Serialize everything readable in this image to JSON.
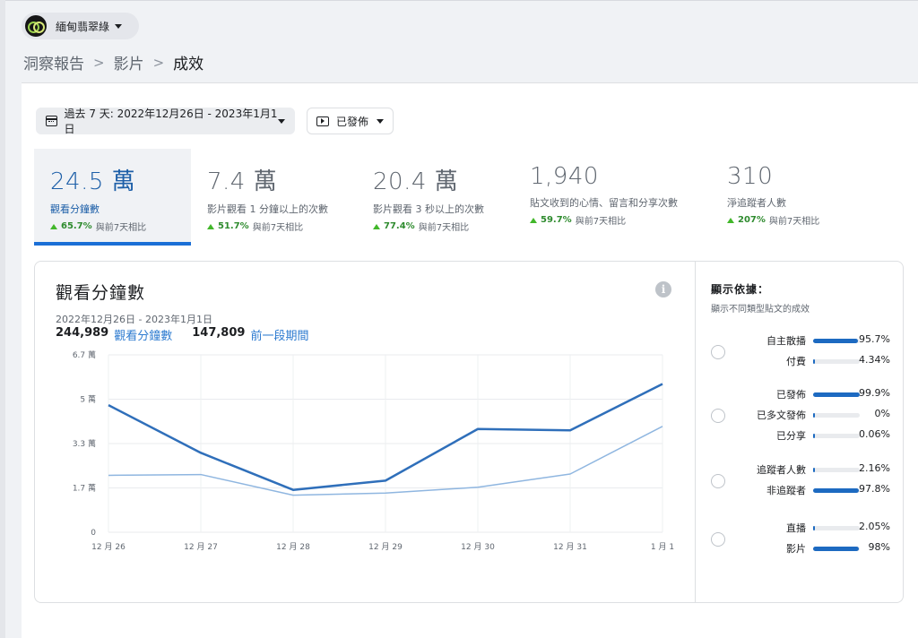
{
  "page_selector": {
    "name": "緬甸翡翠綠"
  },
  "breadcrumb": {
    "items": [
      "洞察報告",
      "影片",
      "成效"
    ],
    "separator": ">"
  },
  "filters": {
    "date_range_label": "過去 7 天: 2022年12月26日 - 2023年1月1日",
    "status_label": "已發佈"
  },
  "metrics": [
    {
      "value": "24.5 萬",
      "label": "觀看分鐘數",
      "change": "65.7%",
      "compare": "與前7天相比",
      "active": true
    },
    {
      "value": "7.4 萬",
      "label": "影片觀看 1 分鐘以上的次數",
      "change": "51.7%",
      "compare": "與前7天相比",
      "active": false
    },
    {
      "value": "20.4 萬",
      "label": "影片觀看 3 秒以上的次數",
      "change": "77.4%",
      "compare": "與前7天相比",
      "active": false
    },
    {
      "value": "1,940",
      "label": "貼文收到的心情、留言和分享次數",
      "change": "59.7%",
      "compare": "與前7天相比",
      "active": false
    },
    {
      "value": "310",
      "label": "淨追蹤者人數",
      "change": "207%",
      "compare": "與前7天相比",
      "active": false
    }
  ],
  "chart_panel": {
    "title": "觀看分鐘數",
    "range": "2022年12月26日 - 2023年1月1日",
    "current_total": "244,989",
    "current_label": "觀看分鐘數",
    "previous_total": "147,809",
    "previous_label": "前一段期間",
    "info_icon": "info-icon"
  },
  "chart_data": {
    "type": "line",
    "categories": [
      "12 月 26",
      "12 月 27",
      "12 月 28",
      "12 月 29",
      "12 月 30",
      "12 月 31",
      "1 月 1"
    ],
    "y_ticks": [
      "0",
      "1.7 萬",
      "3.3 萬",
      "5 萬",
      "6.7 萬"
    ],
    "ylim": [
      0,
      67000
    ],
    "grid": true,
    "series": [
      {
        "name": "觀看分鐘數",
        "values": [
          48000,
          30000,
          16000,
          19500,
          39000,
          38500,
          56000
        ],
        "color": "#2f6fba"
      },
      {
        "name": "前一段期間",
        "values": [
          21500,
          21800,
          14000,
          14800,
          17000,
          22000,
          40000
        ],
        "color": "#8fb6e0"
      }
    ]
  },
  "breakdown": {
    "title": "顯示依據：",
    "subtitle": "顯示不同類型貼文的成效",
    "groups": [
      {
        "rows": [
          {
            "label": "自主散播",
            "value": "95.7%",
            "fraction": 0.957
          },
          {
            "label": "付費",
            "value": "4.34%",
            "fraction": 0.0434
          }
        ]
      },
      {
        "rows": [
          {
            "label": "已發佈",
            "value": "99.9%",
            "fraction": 0.999
          },
          {
            "label": "已多文發佈",
            "value": "0%",
            "fraction": 0
          },
          {
            "label": "已分享",
            "value": "0.06%",
            "fraction": 0.0006
          }
        ]
      },
      {
        "rows": [
          {
            "label": "追蹤者人數",
            "value": "2.16%",
            "fraction": 0.0216
          },
          {
            "label": "非追蹤者",
            "value": "97.8%",
            "fraction": 0.978
          }
        ]
      },
      {
        "rows": [
          {
            "label": "直播",
            "value": "2.05%",
            "fraction": 0.0205
          },
          {
            "label": "影片",
            "value": "98%",
            "fraction": 0.98
          }
        ]
      }
    ]
  }
}
